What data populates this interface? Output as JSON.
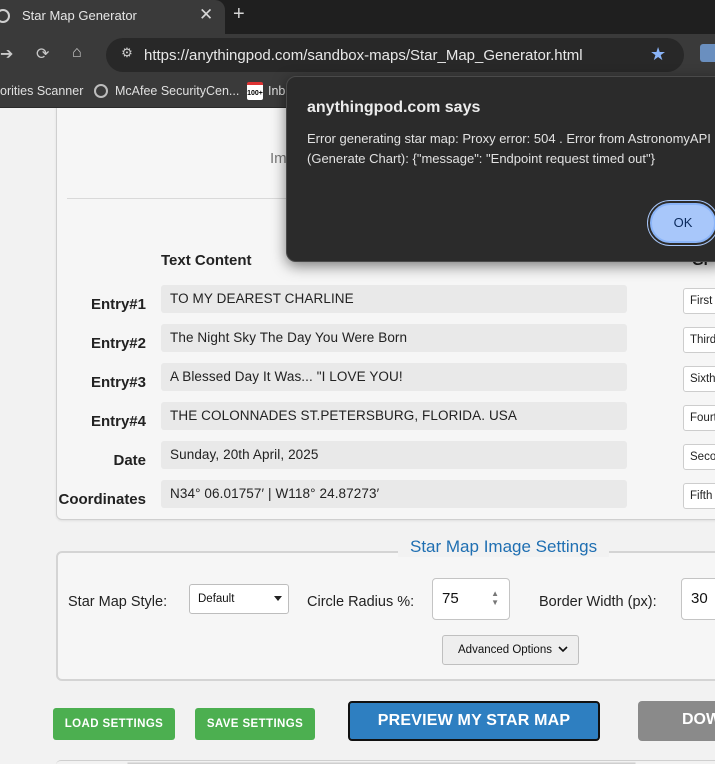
{
  "browser": {
    "tab_title": "Star Map Generator",
    "tab_close": "✕",
    "new_tab": "+",
    "url": "https://anythingpod.com/sandbox-maps/Star_Map_Generator.html",
    "bookmarks": [
      "orities Scanner",
      "McAfee SecurityCen...",
      "Inb"
    ]
  },
  "page": {
    "partial_text": "Im",
    "col_text_header": "Text Content",
    "col_second_header": "Gr",
    "rows": [
      {
        "label": "Entry#1",
        "text": "TO MY DEAREST CHARLINE",
        "option": "First"
      },
      {
        "label": "Entry#2",
        "text": "The Night Sky The Day You Were Born",
        "option": "Third"
      },
      {
        "label": "Entry#3",
        "text": "A Blessed Day It Was... \"I LOVE YOU!",
        "option": "Sixth"
      },
      {
        "label": "Entry#4",
        "text": "THE COLONNADES ST.PETERSBURG, FLORIDA. USA",
        "option": "Fourt"
      },
      {
        "label": "Date",
        "text": "Sunday, 20th April, 2025",
        "option": "Seco"
      },
      {
        "label": "Coordinates",
        "text": "N34° 06.01757′ | W118° 24.87273′",
        "option": "Fifth"
      }
    ],
    "settings": {
      "legend": "Star Map Image Settings",
      "style_label": "Star Map Style:",
      "style_value": "Default",
      "radius_label": "Circle Radius %:",
      "radius_value": "75",
      "border_label": "Border Width (px):",
      "border_value": "30",
      "advanced_label": "Advanced Options"
    },
    "buttons": {
      "load": "LOAD SETTINGS",
      "save": "SAVE SETTINGS",
      "preview": "PREVIEW MY STAR MAP",
      "download": "DOW"
    }
  },
  "dialog": {
    "title": "anythingpod.com says",
    "message": "Error generating star map: Proxy error: 504 . Error from AstronomyAPI (Generate Chart): {\"message\": \"Endpoint request timed out\"}",
    "ok": "OK"
  },
  "colors": {
    "accent_blue": "#2e7fc1",
    "green": "#4caf50",
    "dialog_bg": "#2b2b2b",
    "ok_bg": "#a8c7fa"
  }
}
